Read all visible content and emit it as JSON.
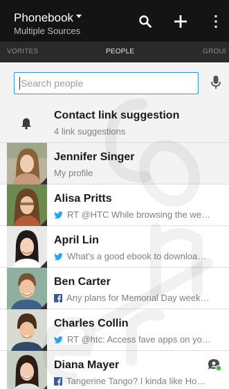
{
  "header": {
    "title": "Phonebook",
    "subtitle": "Multiple Sources",
    "actions": [
      "search-icon",
      "add-icon",
      "overflow-menu-icon"
    ]
  },
  "tabs": [
    {
      "label": "VORITES"
    },
    {
      "label": "PEOPLE",
      "active": true
    },
    {
      "label": "GROUI"
    }
  ],
  "search": {
    "placeholder": "Search people",
    "value": ""
  },
  "contacts": [
    {
      "name": "Contact link suggestion",
      "subtitle": "4 link suggestions",
      "icon": "bell-icon"
    },
    {
      "name": "Jennifer Singer",
      "subtitle": "My profile"
    },
    {
      "name": "Alisa Pritts",
      "subtitle": "RT @HTC While browsing the we…",
      "service": "twitter-icon"
    },
    {
      "name": "April Lin",
      "subtitle": "What's a good ebook to downloa…",
      "service": "twitter-icon"
    },
    {
      "name": "Ben Carter",
      "subtitle": "Any plans for Memorial Day week…",
      "service": "facebook-icon"
    },
    {
      "name": "Charles Collin",
      "subtitle": "RT @htc: Access fave apps on yo…",
      "service": "twitter-icon"
    },
    {
      "name": "Diana Mayer",
      "subtitle": "Tangerine Tango? I kinda like Ho…",
      "service": "facebook-icon",
      "presence": "online"
    }
  ],
  "colors": {
    "header_bg": "#141414",
    "tab_bg": "#2a2a2a",
    "search_border": "#3b8fd6",
    "twitter": "#2aa3ef",
    "facebook": "#3b5b9a",
    "presence_online": "#3fbf3f"
  }
}
